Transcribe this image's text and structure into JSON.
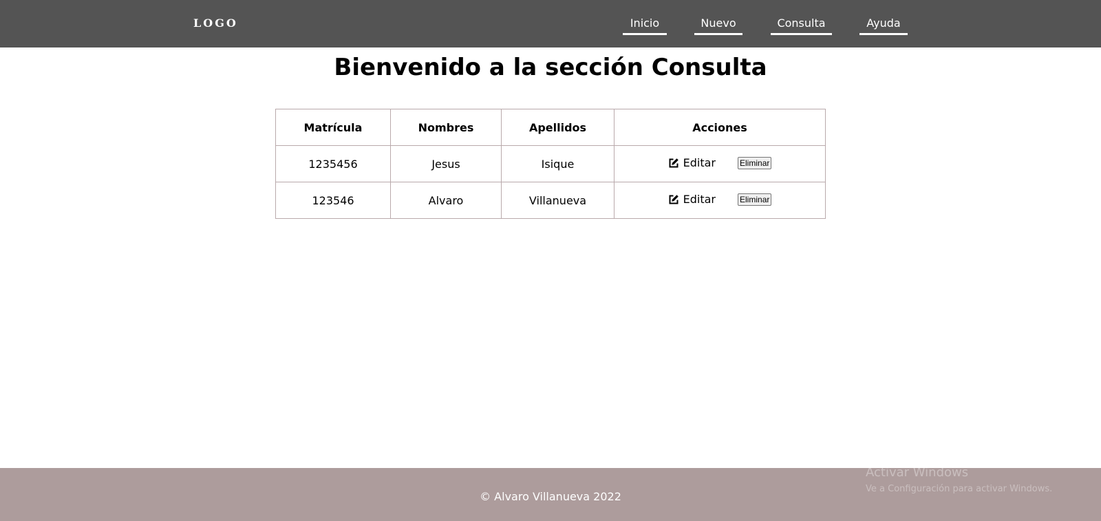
{
  "header": {
    "logo": "LOGO",
    "nav": [
      {
        "label": "Inicio"
      },
      {
        "label": "Nuevo"
      },
      {
        "label": "Consulta"
      },
      {
        "label": "Ayuda"
      }
    ]
  },
  "main": {
    "title": "Bienvenido a la sección Consulta",
    "table": {
      "headers": [
        "Matrícula",
        "Nombres",
        "Apellidos",
        "Acciones"
      ],
      "rows": [
        {
          "matricula": "1235456",
          "nombres": "Jesus",
          "apellidos": "Isique",
          "edit_label": "Editar",
          "delete_label": "Eliminar"
        },
        {
          "matricula": "123546",
          "nombres": "Alvaro",
          "apellidos": "Villanueva",
          "edit_label": "Editar",
          "delete_label": "Eliminar"
        }
      ]
    }
  },
  "footer": {
    "text": "© Alvaro Villanueva 2022"
  },
  "watermark": {
    "title": "Activar Windows",
    "subtitle": "Ve a Configuración para activar Windows."
  },
  "colors": {
    "nav_bg": "#545454",
    "footer_bg": "#ad9c9c",
    "table_border": "#b9a9ab"
  }
}
